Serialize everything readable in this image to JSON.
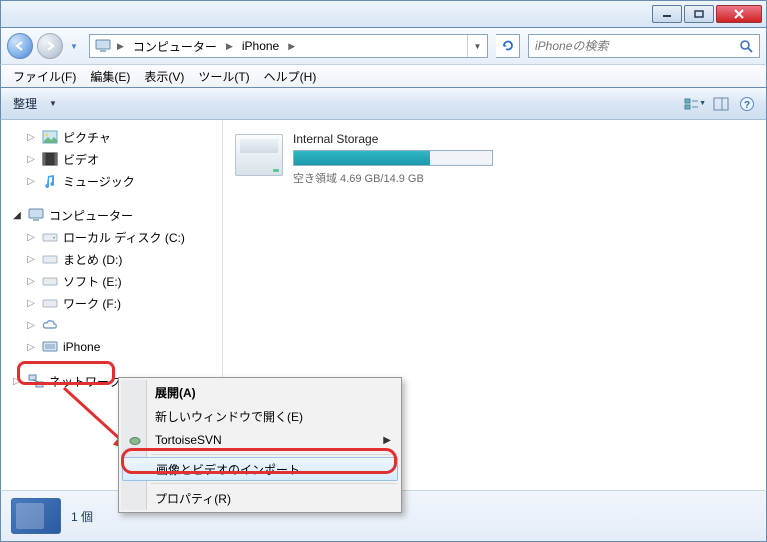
{
  "breadcrumb": {
    "root": "コンピューター",
    "current": "iPhone"
  },
  "search": {
    "placeholder": "iPhoneの検索"
  },
  "menu": {
    "file": "ファイル(F)",
    "edit": "編集(E)",
    "view": "表示(V)",
    "tools": "ツール(T)",
    "help": "ヘルプ(H)"
  },
  "toolbar": {
    "organize": "整理"
  },
  "tree": {
    "libraries": [
      {
        "label": "ピクチャ",
        "icon": "picture-icon"
      },
      {
        "label": "ビデオ",
        "icon": "video-icon"
      },
      {
        "label": "ミュージック",
        "icon": "music-icon"
      }
    ],
    "computer": "コンピューター",
    "drives": [
      {
        "label": "ローカル ディスク (C:)"
      },
      {
        "label": "まとめ (D:)"
      },
      {
        "label": "ソフト (E:)"
      },
      {
        "label": "ワーク (F:)"
      },
      {
        "label": ""
      },
      {
        "label": "iPhone",
        "device": true
      }
    ],
    "network": "ネットワーク"
  },
  "storage": {
    "title": "Internal Storage",
    "free_text": "空き領域 4.69 GB/14.9 GB"
  },
  "context_menu": {
    "open": "展開(A)",
    "new_window": "新しいウィンドウで開く(E)",
    "tortoise": "TortoiseSVN",
    "import": "画像とビデオのインポート",
    "properties": "プロパティ(R)"
  },
  "status": {
    "count": "1 個"
  }
}
